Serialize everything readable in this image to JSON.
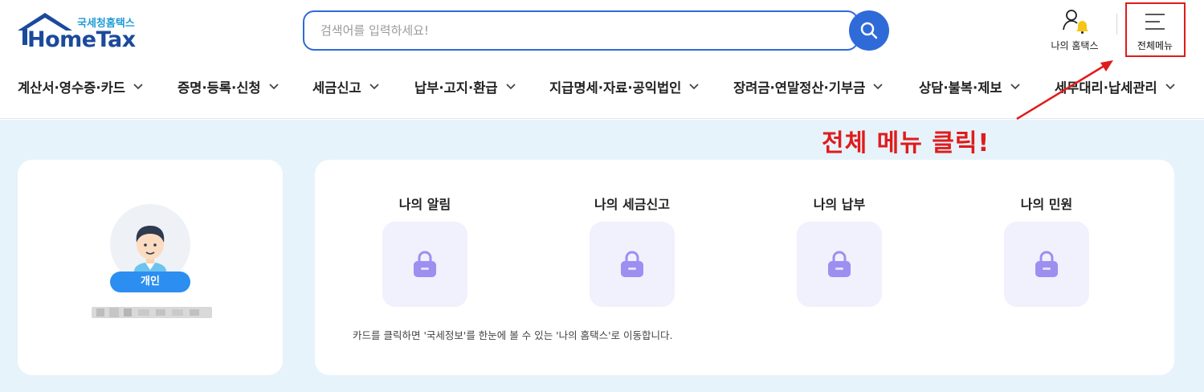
{
  "header": {
    "logo_subtitle": "국세청홈택스",
    "logo_title": "HomeTax",
    "search": {
      "placeholder": "검색어를 입력하세요!",
      "icon": "search-icon"
    },
    "my_hometax_label": "나의 홈택스",
    "all_menu_label": "전체메뉴"
  },
  "nav": {
    "items": [
      {
        "label": "계산서·영수증·카드"
      },
      {
        "label": "증명·등록·신청"
      },
      {
        "label": "세금신고"
      },
      {
        "label": "납부·고지·환급"
      },
      {
        "label": "지급명세·자료·공익법인"
      },
      {
        "label": "장려금·연말정산·기부금"
      },
      {
        "label": "상담·불복·제보"
      },
      {
        "label": "세무대리·납세관리"
      }
    ]
  },
  "profile": {
    "badge": "개인"
  },
  "summary": {
    "tiles": [
      {
        "title": "나의 알림",
        "icon": "lock-icon"
      },
      {
        "title": "나의 세금신고",
        "icon": "lock-icon"
      },
      {
        "title": "나의 납부",
        "icon": "lock-icon"
      },
      {
        "title": "나의 민원",
        "icon": "lock-icon"
      }
    ],
    "note": "카드를 클릭하면 '국세정보'를 한눈에 볼 수 있는 '나의 홈택스'로 이동합니다."
  },
  "annotation": {
    "text": "전체 메뉴 클릭!"
  },
  "colors": {
    "brand_blue": "#2f6ad9",
    "logo_navy": "#1b4a9c",
    "annotation_red": "#e01b1b",
    "background": "#e7f3fb",
    "lock_purple": "#9b8ff0",
    "tile_bg": "#f1f0fd"
  }
}
